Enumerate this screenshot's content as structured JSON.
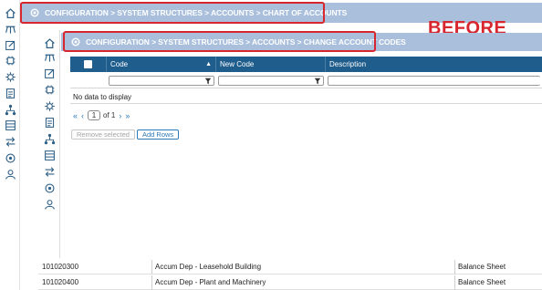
{
  "outer": {
    "breadcrumb": "CONFIGURATION > SYSTEM STRUCTURES > ACCOUNTS > CHART OF ACCOUNTS"
  },
  "annotation": {
    "label": "BEFORE"
  },
  "inner": {
    "breadcrumb": "CONFIGURATION > SYSTEM STRUCTURES > ACCOUNTS > CHANGE ACCOUNT CODES"
  },
  "grid": {
    "columns": [
      "Code",
      "New Code",
      "Description"
    ],
    "empty_text": "No data to display"
  },
  "pager": {
    "first": "«",
    "prev": "‹",
    "page": "1",
    "of_text": "of 1",
    "next": "›",
    "last": "»"
  },
  "buttons": {
    "remove_selected": "Remove selected",
    "add_rows": "Add Rows"
  },
  "background_rows": [
    {
      "code": "101020300",
      "description": "Accum Dep - Leasehold Building",
      "type": "Balance Sheet"
    },
    {
      "code": "101020400",
      "description": "Accum Dep - Plant and Machinery",
      "type": "Balance Sheet"
    }
  ],
  "colors": {
    "accent_red": "#d7262e",
    "breadcrumb_bar": "#a9bfdc",
    "grid_header": "#1f5d8d",
    "link_blue": "#2d7ab8"
  },
  "icons": {
    "sidebar": [
      "home-icon",
      "hierarchy-icon",
      "edit-icon",
      "chip-icon",
      "settings-cog-icon",
      "list-icon",
      "org-chart-icon",
      "archive-icon",
      "exchange-icon",
      "gear-icon",
      "users-icon"
    ]
  }
}
